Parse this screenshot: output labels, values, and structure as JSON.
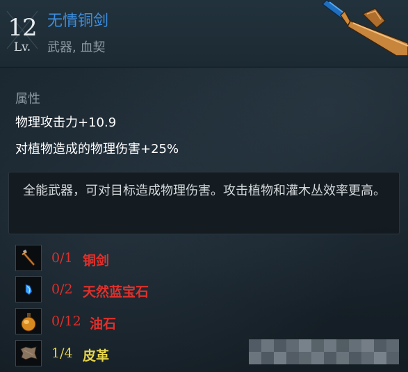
{
  "header": {
    "level_number": "12",
    "level_label": "Lv.",
    "item_name": "无情铜剑",
    "item_type": "武器, 血契",
    "icon": "bronze-sword-icon"
  },
  "attributes": {
    "title": "属性",
    "lines": [
      "物理攻击力+10.9",
      "对植物造成的物理伤害+25%"
    ]
  },
  "description": {
    "text": "全能武器，可对目标造成物理伤害。攻击植物和灌木丛效率更高。"
  },
  "materials": [
    {
      "count": "0/1",
      "name": "铜剑",
      "icon": "bronze-sword-icon",
      "status": "insufficient"
    },
    {
      "count": "0/2",
      "name": "天然蓝宝石",
      "icon": "sapphire-icon",
      "status": "insufficient"
    },
    {
      "count": "0/12",
      "name": "油石",
      "icon": "whetstone-oil-icon",
      "status": "insufficient"
    },
    {
      "count": "1/4",
      "name": "皮革",
      "icon": "leather-icon",
      "status": "partial"
    }
  ],
  "colors": {
    "item_name": "#3d8fe0",
    "insufficient": "#e0302b",
    "partial": "#e6d54a",
    "secondary_text": "#8e9aa3"
  }
}
